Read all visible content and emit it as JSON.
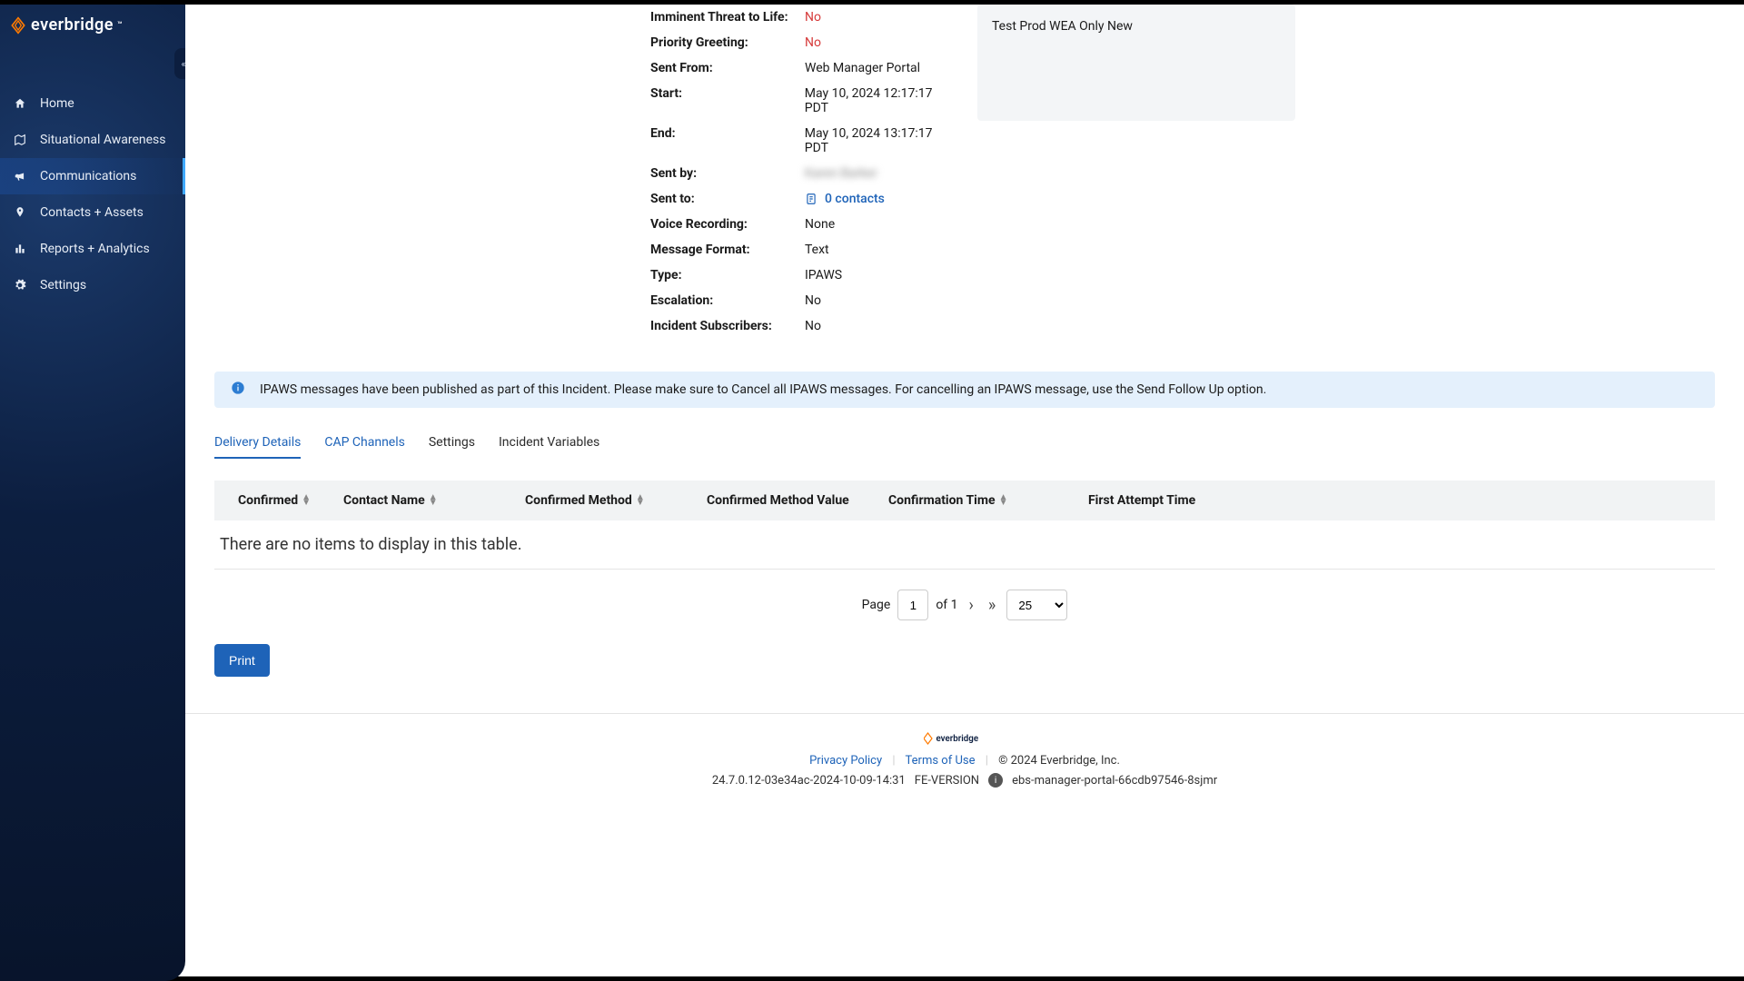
{
  "brand": "everbridge",
  "sidebar": {
    "items": [
      {
        "label": "Home"
      },
      {
        "label": "Situational Awareness"
      },
      {
        "label": "Communications"
      },
      {
        "label": "Contacts + Assets"
      },
      {
        "label": "Reports + Analytics"
      },
      {
        "label": "Settings"
      }
    ]
  },
  "details": {
    "imminent_threat_label": "Imminent Threat to Life:",
    "imminent_threat_value": "No",
    "priority_label": "Priority Greeting:",
    "priority_value": "No",
    "sent_from_label": "Sent From:",
    "sent_from_value": "Web Manager Portal",
    "start_label": "Start:",
    "start_value": "May 10, 2024 12:17:17 PDT",
    "end_label": "End:",
    "end_value": "May 10, 2024 13:17:17 PDT",
    "sent_by_label": "Sent by:",
    "sent_by_value": "Karen Barker",
    "sent_to_label": "Sent to:",
    "sent_to_value": "0  contacts",
    "voice_label": "Voice Recording:",
    "voice_value": "None",
    "format_label": "Message Format:",
    "format_value": "Text",
    "type_label": "Type:",
    "type_value": "IPAWS",
    "escalation_label": "Escalation:",
    "escalation_value": "No",
    "subscribers_label": "Incident Subscribers:",
    "subscribers_value": "No"
  },
  "side_card_text": "Test Prod WEA Only New",
  "info_banner": "IPAWS messages have been published as part of this Incident. Please make sure to Cancel all IPAWS messages. For cancelling an IPAWS message, use the Send Follow Up option.",
  "tabs": {
    "delivery": "Delivery Details",
    "cap": "CAP Channels",
    "settings": "Settings",
    "incident": "Incident Variables"
  },
  "table": {
    "headers": {
      "confirmed": "Confirmed",
      "name": "Contact Name",
      "method": "Confirmed Method",
      "value": "Confirmed Method Value",
      "time": "Confirmation Time",
      "attempt": "First Attempt Time"
    },
    "empty": "There are no items to display in this table."
  },
  "pager": {
    "page_label": "Page",
    "page_value": "1",
    "of_label": "of 1",
    "page_size": "25"
  },
  "print_label": "Print",
  "footer": {
    "privacy": "Privacy Policy",
    "terms": "Terms of Use",
    "copyright": "© 2024 Everbridge, Inc.",
    "build": "24.7.0.12-03e34ac-2024-10-09-14:31",
    "fe": "FE-VERSION",
    "host": "ebs-manager-portal-66cdb97546-8sjmr"
  }
}
